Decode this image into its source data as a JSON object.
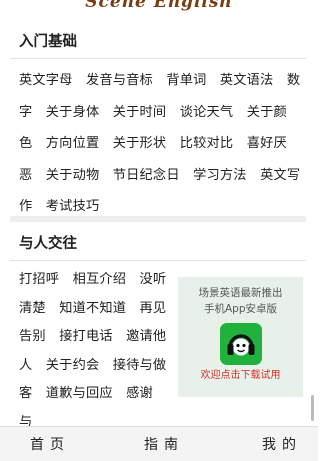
{
  "app": {
    "logo_text": "Scene English"
  },
  "section_basics": {
    "title": "入门基础",
    "items": [
      "英文字母",
      "发音与音标",
      "背单词",
      "英文语法",
      "数字",
      "关于身体",
      "关于时间",
      "谈论天气",
      "关于颜色",
      "方向位置",
      "关于形状",
      "比较对比",
      "喜好厌恶",
      "关于动物",
      "节日纪念日",
      "学习方法",
      "英文写作",
      "考试技巧"
    ]
  },
  "section_social": {
    "title": "与人交往",
    "items": [
      "打招呼",
      "相互介绍",
      "没听清楚",
      "知道不知道",
      "再见告别",
      "接打电话",
      "邀请他人",
      "关于约会",
      "接待与做客",
      "道歉与回应",
      "感谢与"
    ]
  },
  "promo": {
    "line1": "场景英语最新推出",
    "line2": "手机App安卓版",
    "icon": "headphones-robot-icon",
    "cta": "欢迎点击下载试用",
    "accent": "#20b23c"
  },
  "bottom_nav": {
    "home": "首页",
    "guide": "指南",
    "mine": "我的"
  }
}
